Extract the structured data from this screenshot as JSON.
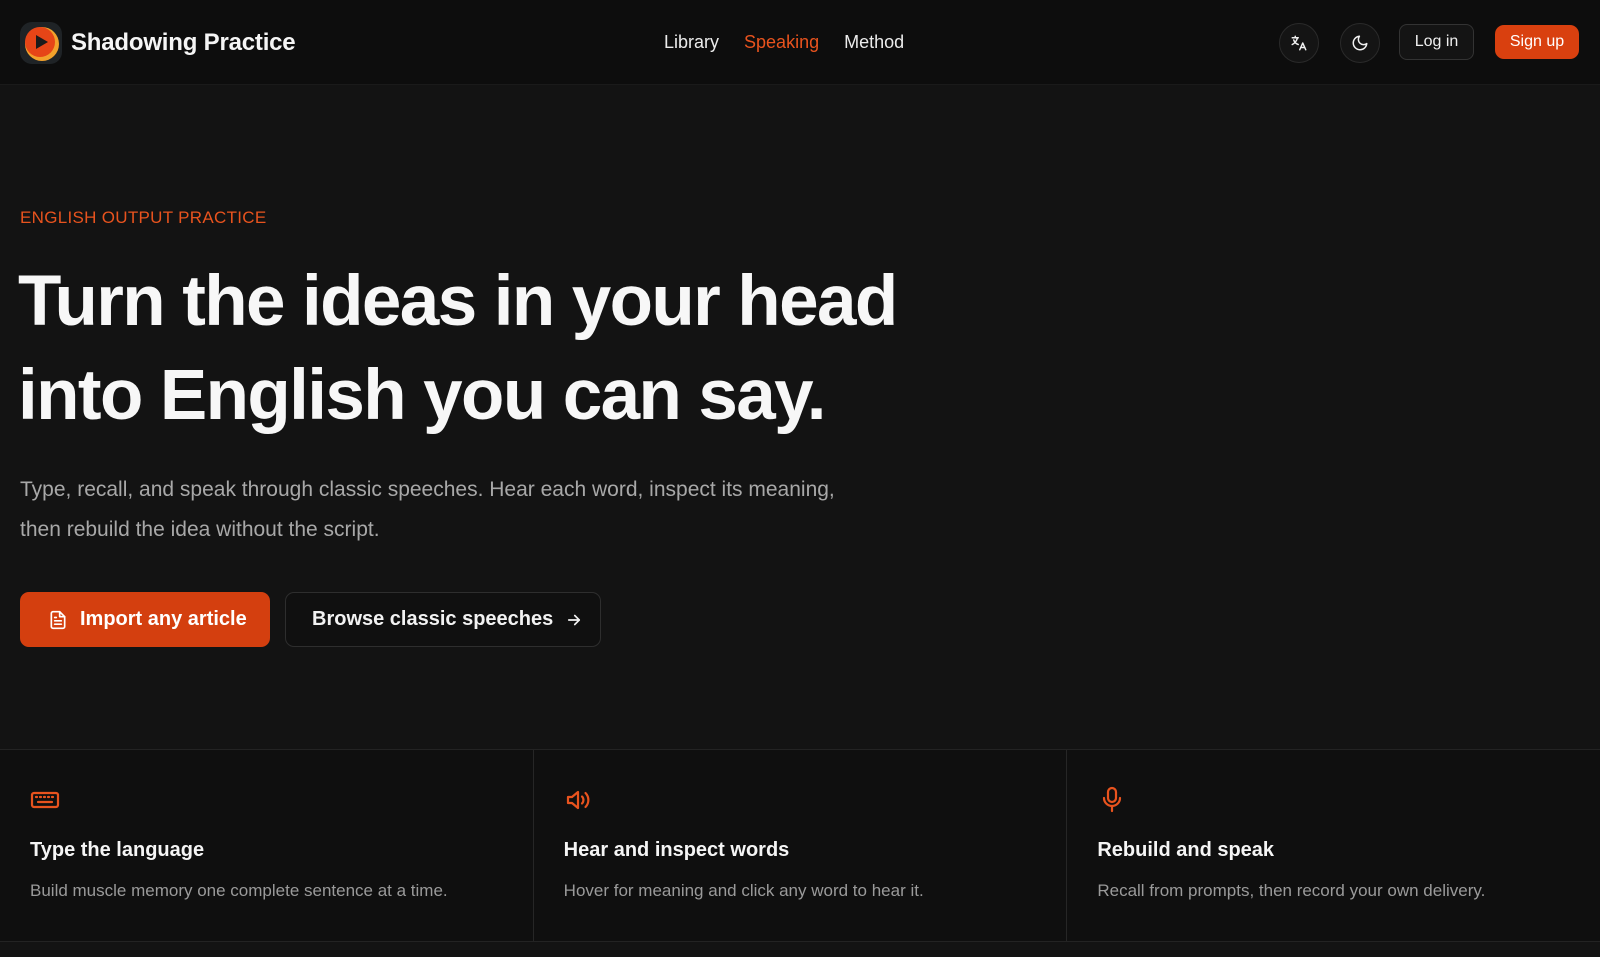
{
  "header": {
    "app_name": "Shadowing Practice",
    "nav": [
      {
        "label": "Library",
        "active": false
      },
      {
        "label": "Speaking",
        "active": true
      },
      {
        "label": "Method",
        "active": false
      }
    ],
    "translate_icon": "translate-icon",
    "theme_icon": "moon-icon",
    "login_label": "Log in",
    "signup_label": "Sign up"
  },
  "hero": {
    "eyebrow": "ENGLISH OUTPUT PRACTICE",
    "headline_line1": "Turn the ideas in your head",
    "headline_line2": "into English you can say.",
    "subcopy": "Type, recall, and speak through classic speeches. Hear each word, inspect its meaning, then rebuild the idea without the script.",
    "primary_cta": "Import any article",
    "secondary_cta": "Browse classic speeches"
  },
  "features": [
    {
      "icon": "keyboard-icon",
      "title": "Type the language",
      "desc": "Build muscle memory one complete sentence at a time."
    },
    {
      "icon": "speaker-icon",
      "title": "Hear and inspect words",
      "desc": "Hover for meaning and click any word to hear it."
    },
    {
      "icon": "microphone-icon",
      "title": "Rebuild and speak",
      "desc": "Recall from prompts, then record your own delivery."
    }
  ],
  "colors": {
    "accent": "#e8531e",
    "button": "#d43f0f",
    "background": "#131313"
  }
}
